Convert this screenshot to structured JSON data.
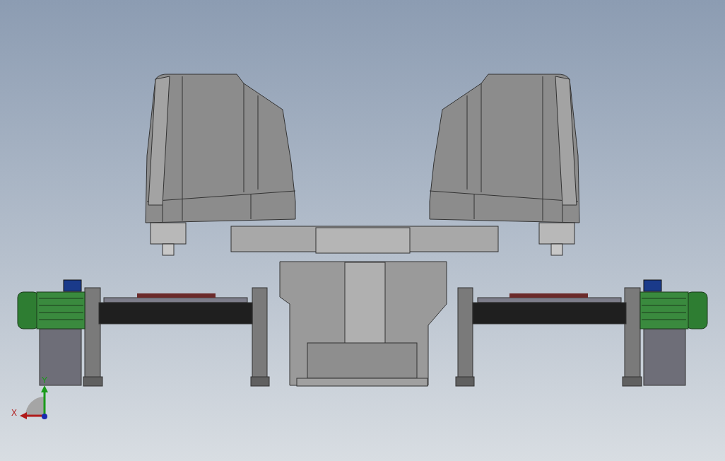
{
  "triad": {
    "x_label": "X",
    "y_label": "Y"
  }
}
